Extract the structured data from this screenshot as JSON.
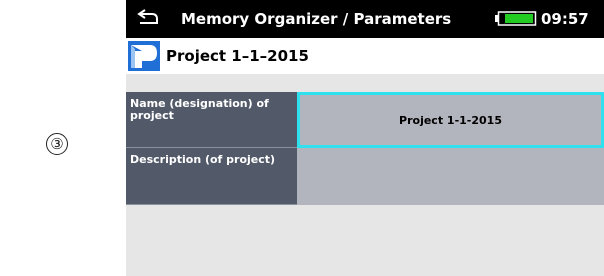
{
  "step_marker": "③",
  "titlebar": {
    "title": "Memory Organizer / Parameters",
    "clock": "09:57",
    "back_icon": "back-arrow-icon",
    "battery_icon": "battery-full-icon",
    "battery_color": "#22cc22"
  },
  "project": {
    "name": "Project 1–1–2015",
    "icon": "project-folder-icon",
    "icon_color": "#1f6fd6"
  },
  "parameters": [
    {
      "label": "Name (designation) of project",
      "value": "Project 1-1-2015",
      "selected": true
    },
    {
      "label": "Description (of project)",
      "value": "",
      "selected": false
    }
  ],
  "colors": {
    "label_bg": "#525a6a",
    "value_bg": "#b3b5be",
    "selection_border": "#2fe0ee"
  }
}
